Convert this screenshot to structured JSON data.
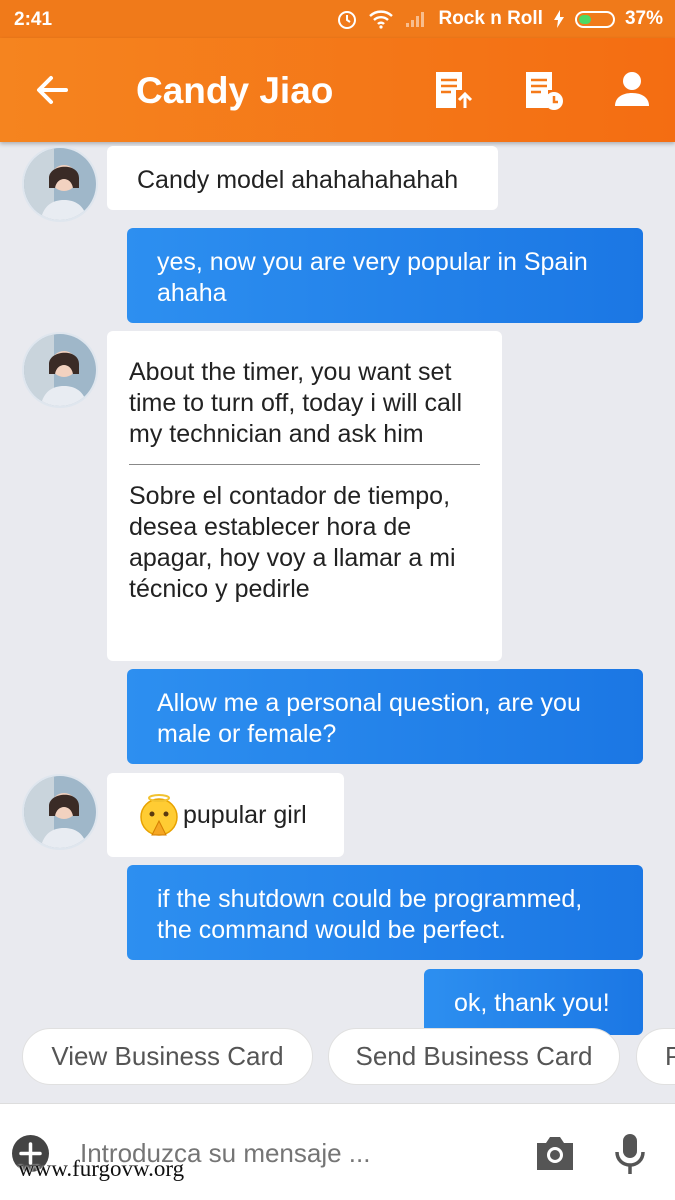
{
  "status_bar": {
    "time": "2:41",
    "carrier": "Rock n Roll",
    "battery": "37%",
    "battery_level": 0.37
  },
  "header": {
    "title": "Candy Jiao",
    "back_icon": "arrow-left-icon",
    "actions": [
      "document-upload-icon",
      "document-clock-icon",
      "person-icon"
    ]
  },
  "messages": [
    {
      "dir": "in",
      "text": "Candy model ahahahahahah"
    },
    {
      "dir": "out",
      "text": "yes, now you are very popular in Spain ahaha"
    },
    {
      "dir": "in",
      "text": "About the timer, you want set time to turn off, today i will call my technician and ask him",
      "translation": "Sobre el contador de tiempo, desea establecer hora de apagar, hoy voy a llamar a mi técnico y pedirle"
    },
    {
      "dir": "out",
      "text": "Allow me a personal question, are you male or female?"
    },
    {
      "dir": "in",
      "emoji": "praying-emoji",
      "text": "pupular girl"
    },
    {
      "dir": "out",
      "text": "if the shutdown could be programmed, the command would be perfect."
    },
    {
      "dir": "out",
      "text": "ok, thank you!"
    }
  ],
  "quick_replies": [
    "View Business Card",
    "Send Business Card",
    "P"
  ],
  "composer": {
    "placeholder": "Introduzca su mensaje ..."
  },
  "watermark": "www.furgovw.org",
  "colors": {
    "accent": "#f5841f",
    "outgoing": "#2185ea",
    "background": "#e9eaef"
  }
}
